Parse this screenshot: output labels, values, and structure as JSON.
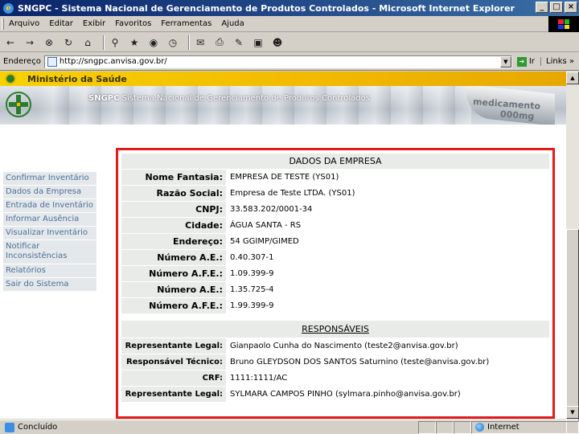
{
  "window": {
    "title": "SNGPC - Sistema Nacional de Gerenciamento de Produtos Controlados - Microsoft Internet Explorer",
    "buttons": [
      "_",
      "□",
      "×"
    ]
  },
  "menu": [
    "Arquivo",
    "Editar",
    "Exibir",
    "Favoritos",
    "Ferramentas",
    "Ajuda"
  ],
  "toolbar_icons": [
    "back-icon",
    "forward-icon",
    "stop-icon",
    "refresh-icon",
    "home-icon",
    "search-icon",
    "favorites-icon",
    "media-icon",
    "history-icon",
    "mail-icon",
    "print-icon",
    "edit-icon",
    "discuss-icon",
    "messenger-icon"
  ],
  "address": {
    "label": "Endereço",
    "url": "http://sngpc.anvisa.gov.br/",
    "go": "Ir",
    "links": "Links"
  },
  "header": {
    "ministry": "Ministério da Saúde",
    "banner_sngpc": "SNGPC",
    "banner_text": "Sistema Nacional de Gerenciamento de Produtos Controlados",
    "banner_med": "medicamento",
    "banner_mg": "000mg",
    "colors": {
      "gold": "#f2b800",
      "green": "#2a7d2e"
    }
  },
  "sidebar": {
    "items": [
      {
        "label": "Confirmar Inventário"
      },
      {
        "label": "Dados da Empresa"
      },
      {
        "label": "Entrada de Inventário"
      },
      {
        "label": "Informar Ausência"
      },
      {
        "label": "Visualizar Inventário"
      },
      {
        "label": "Notificar Inconsistências"
      },
      {
        "label": "Relatórios"
      },
      {
        "label": "Sair do Sistema"
      }
    ]
  },
  "empresa": {
    "heading": "DADOS DA EMPRESA",
    "rows": [
      {
        "label": "Nome Fantasia:",
        "value": "EMPRESA DE TESTE (YS01)"
      },
      {
        "label": "Razão Social:",
        "value": "Empresa de Teste LTDA. (YS01)"
      },
      {
        "label": "CNPJ:",
        "value": "33.583.202/0001-34"
      },
      {
        "label": "Cidade:",
        "value": "ÁGUA SANTA - RS"
      },
      {
        "label": "Endereço:",
        "value": "54 GGIMP/GIMED"
      },
      {
        "label": "Número A.E.:",
        "value": "0.40.307-1"
      },
      {
        "label": "Número A.F.E.:",
        "value": "1.09.399-9"
      },
      {
        "label": "Número A.E.:",
        "value": "1.35.725-4"
      },
      {
        "label": "Número A.F.E.:",
        "value": "1.99.399-9"
      }
    ]
  },
  "responsaveis": {
    "heading": "RESPONSÁVEIS",
    "rows": [
      {
        "label": "Representante Legal:",
        "value": "Gianpaolo Cunha do Nascimento (teste2@anvisa.gov.br)"
      },
      {
        "label": "Responsável Técnico:",
        "value": "Bruno GLEYDSON DOS SANTOS Saturnino (teste@anvisa.gov.br)"
      },
      {
        "label": "CRF:",
        "value": "1111:1111/AC"
      },
      {
        "label": "Representante Legal:",
        "value": "SYLMARA CAMPOS PINHO (sylmara.pinho@anvisa.gov.br)"
      }
    ]
  },
  "status": {
    "text": "Concluído",
    "zone": "Internet"
  },
  "panel_highlight_color": "#e41b1b"
}
